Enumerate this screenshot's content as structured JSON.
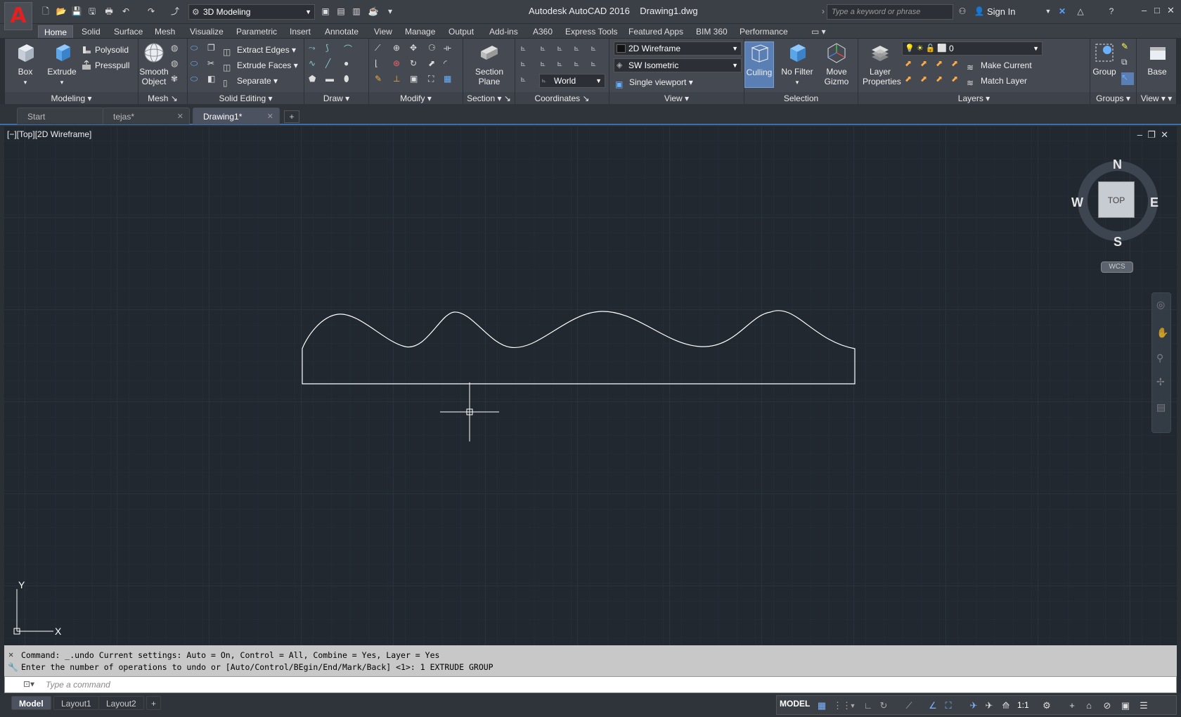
{
  "title_bar": {
    "workspace": "3D Modeling",
    "app_title": "Autodesk AutoCAD 2016",
    "file_name": "Drawing1.dwg",
    "search_placeholder": "Type a keyword or phrase",
    "sign_in": "Sign In"
  },
  "ribbon_tabs": [
    "Home",
    "Solid",
    "Surface",
    "Mesh",
    "Visualize",
    "Parametric",
    "Insert",
    "Annotate",
    "View",
    "Manage",
    "Output",
    "Add-ins",
    "A360",
    "Express Tools",
    "Featured Apps",
    "BIM 360",
    "Performance"
  ],
  "ribbon": {
    "modeling": {
      "title": "Modeling",
      "box": "Box",
      "extrude": "Extrude",
      "polysolid": "Polysolid",
      "presspull": "Presspull"
    },
    "mesh": {
      "title": "Mesh",
      "smooth_object": "Smooth Object"
    },
    "solid_editing": {
      "title": "Solid Editing",
      "extract_edges": "Extract Edges",
      "extrude_faces": "Extrude Faces",
      "separate": "Separate"
    },
    "draw": {
      "title": "Draw"
    },
    "modify": {
      "title": "Modify"
    },
    "section": {
      "title": "Section",
      "section_plane": "Section Plane"
    },
    "coordinates": {
      "title": "Coordinates",
      "ucs": "World"
    },
    "view": {
      "title": "View",
      "visual_style": "2D Wireframe",
      "view_preset": "SW Isometric",
      "viewport": "Single viewport"
    },
    "selection": {
      "title": "Selection",
      "culling": "Culling",
      "no_filter": "No Filter",
      "move_gizmo": "Move Gizmo"
    },
    "layers": {
      "title": "Layers",
      "layer_properties": "Layer Properties",
      "layer_value": "0",
      "make_current": "Make Current",
      "match_layer": "Match Layer"
    },
    "groups": {
      "title": "Groups",
      "group": "Group"
    },
    "view2": {
      "title": "View",
      "base": "Base"
    }
  },
  "doc_tabs": [
    {
      "label": "Start"
    },
    {
      "label": "tejas*"
    },
    {
      "label": "Drawing1*"
    }
  ],
  "viewport": {
    "label": "[−][Top][2D Wireframe]",
    "compass": {
      "n": "N",
      "s": "S",
      "e": "E",
      "w": "W",
      "top": "TOP",
      "wcs": "WCS"
    },
    "ucs": {
      "x": "X",
      "y": "Y"
    }
  },
  "command": {
    "line1": "Command: _.undo Current settings: Auto = On, Control = All, Combine = Yes, Layer = Yes",
    "line2": "Enter the number of operations to undo or [Auto/Control/BEgin/End/Mark/Back] <1>: 1 EXTRUDE GROUP",
    "placeholder": "Type a command"
  },
  "layout_tabs": [
    "Model",
    "Layout1",
    "Layout2"
  ],
  "status": {
    "model": "MODEL",
    "scale": "1:1"
  },
  "colors": {
    "canvas": "#212830",
    "ribbon": "#454a52",
    "accent": "#3d6fae"
  }
}
